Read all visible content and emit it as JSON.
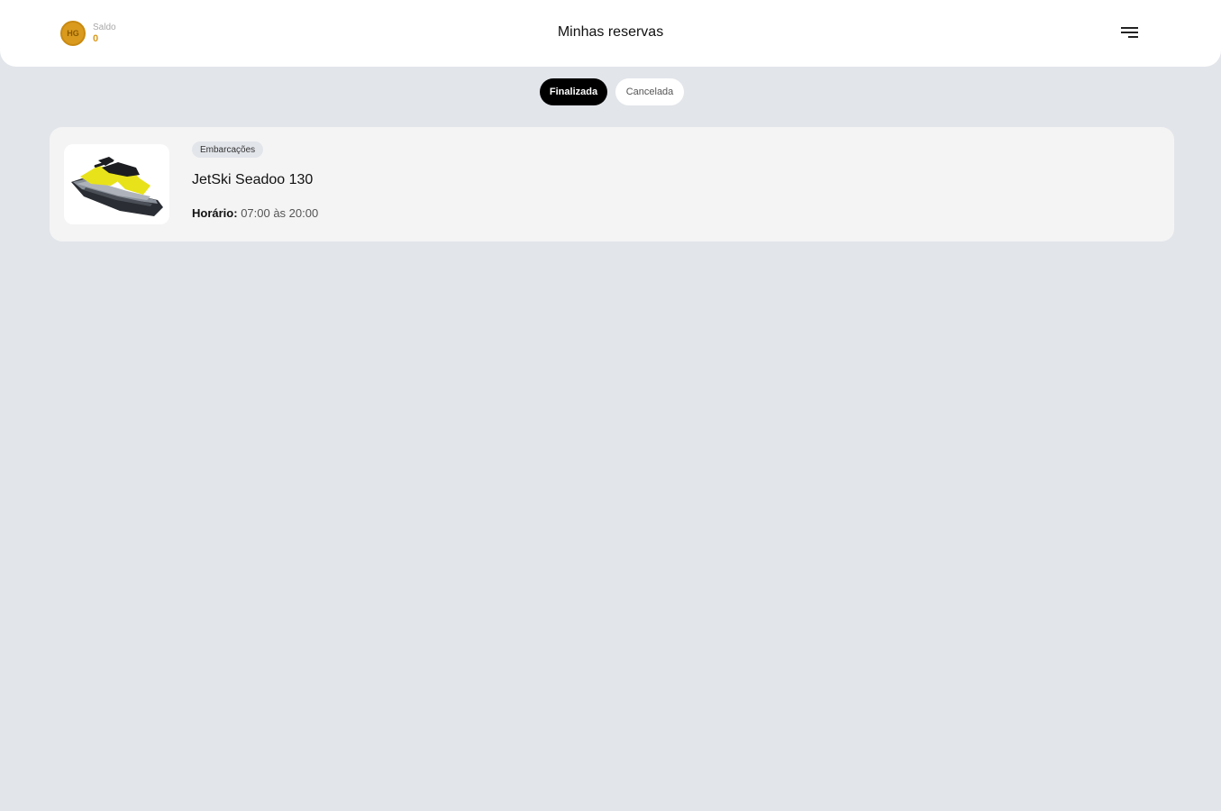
{
  "header": {
    "balance_label": "Saldo",
    "balance_value": "0",
    "coin_text": "HG",
    "title": "Minhas reservas",
    "menu_icon": "filter-menu-icon"
  },
  "tabs": [
    {
      "label": "Finalizada",
      "active": true
    },
    {
      "label": "Cancelada",
      "active": false
    }
  ],
  "reservations": [
    {
      "category": "Embarcações",
      "name": "JetSki Seadoo 130",
      "schedule_label": "Horário:",
      "schedule_value": "07:00 às 20:00",
      "image": "jetski-image"
    }
  ],
  "colors": {
    "accent": "#d99a1e",
    "background": "#e2e5ea",
    "active_tab": "#000000"
  }
}
